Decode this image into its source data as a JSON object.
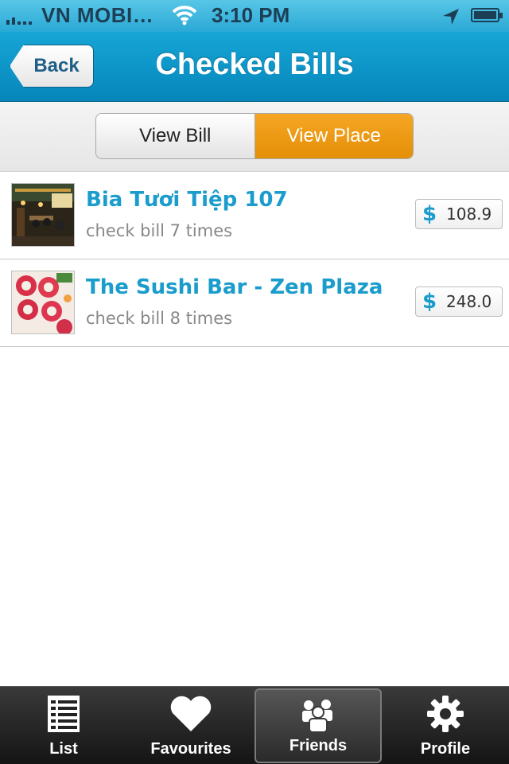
{
  "status_bar": {
    "carrier": "VN MOBI…",
    "time": "3:10 PM",
    "icons": [
      "signal-icon",
      "wifi-icon",
      "location-arrow-icon",
      "battery-icon"
    ]
  },
  "nav": {
    "back_label": "Back",
    "title": "Checked Bills"
  },
  "segments": {
    "view_bill": "View Bill",
    "view_place": "View Place",
    "selected": "view_place"
  },
  "places": [
    {
      "name": "Bia Tươi Tiệp 107",
      "subtitle": "check bill 7 times",
      "currency_symbol": "$",
      "amount": "108.9"
    },
    {
      "name": "The Sushi Bar - Zen Plaza",
      "subtitle": "check bill 8 times",
      "currency_symbol": "$",
      "amount": "248.0"
    }
  ],
  "tabs": [
    {
      "label": "List",
      "icon": "list-icon"
    },
    {
      "label": "Favourites",
      "icon": "heart-icon"
    },
    {
      "label": "Friends",
      "icon": "friends-icon",
      "active": true
    },
    {
      "label": "Profile",
      "icon": "gear-icon"
    }
  ],
  "colors": {
    "nav_blue": "#0b95c9",
    "accent_orange": "#f0a11a",
    "link_blue": "#1a9ccc",
    "tab_bar": "#222222"
  }
}
